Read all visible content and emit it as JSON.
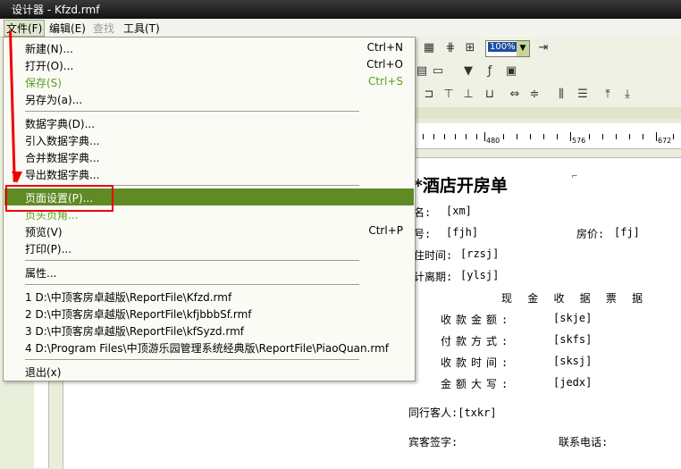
{
  "window": {
    "title": "设计器 - Kfzd.rmf"
  },
  "menubar": {
    "file": "文件(F)",
    "edit": "编辑(E)",
    "view": "查找",
    "tools": "工具(T)"
  },
  "toolbar": {
    "zoom_value": "100%"
  },
  "ruler": {
    "labels": [
      "480",
      "576",
      "672"
    ]
  },
  "file_menu": {
    "new": {
      "label": "新建(N)...",
      "shortcut": "Ctrl+N"
    },
    "open": {
      "label": "打开(O)...",
      "shortcut": "Ctrl+O"
    },
    "save": {
      "label": "保存(S)",
      "shortcut": "Ctrl+S"
    },
    "save_as": {
      "label": "另存为(a)..."
    },
    "data_dict": {
      "label": "数据字典(D)..."
    },
    "import_dict": {
      "label": "引入数据字典..."
    },
    "merge_dict": {
      "label": "合并数据字典..."
    },
    "export_dict": {
      "label": "导出数据字典..."
    },
    "page_setup": {
      "label": "页面设置(P)..."
    },
    "header_footer": {
      "label": "页头页角..."
    },
    "preview": {
      "label": "预览(V)",
      "shortcut": "Ctrl+P"
    },
    "print": {
      "label": "打印(P)..."
    },
    "properties": {
      "label": "属性..."
    },
    "recent": [
      "1 D:\\中顶客房卓越版\\ReportFile\\Kfzd.rmf",
      "2 D:\\中顶客房卓越版\\ReportFile\\kfjbbbSf.rmf",
      "3 D:\\中顶客房卓越版\\ReportFile\\kfSyzd.rmf",
      "4 D:\\Program Files\\中顶游乐园管理系统经典版\\ReportFile\\PiaoQuan.rmf"
    ],
    "exit": {
      "label": "退出(x)"
    }
  },
  "report": {
    "title": "*酒店开房单",
    "name_label": "名:",
    "name_field": "[xm]",
    "room_no_label": "号:",
    "room_no_field": "[fjh]",
    "price_label": "房价:",
    "price_field": "[fj]",
    "checkin_label": "住时间:",
    "checkin_field": "[rzsj]",
    "checkout_label": "计离期:",
    "checkout_field": "[ylsj]",
    "receipt_title": "现 金 收 据 票 据",
    "amount_label": "收款金额:",
    "amount_field": "[skje]",
    "method_label": "付款方式:",
    "method_field": "[skfs]",
    "time_label": "收款时间:",
    "time_field": "[sksj]",
    "upper_label": "金额大写:",
    "upper_field": "[jedx]",
    "companion": "同行客人:[txkr]",
    "signature": "宾客签字:",
    "phone": "联系电话:"
  }
}
